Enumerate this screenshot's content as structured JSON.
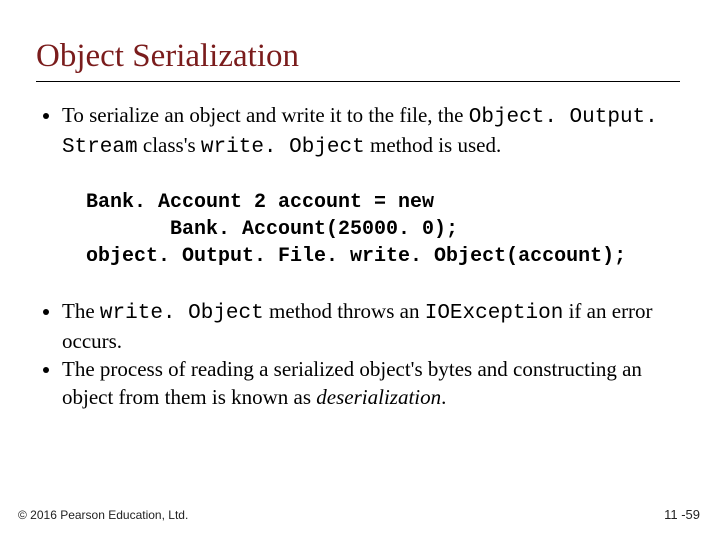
{
  "title": "Object Serialization",
  "bullets": {
    "b1_pre": "To serialize an object and write it to the file, the ",
    "b1_code1": "Object. Output. Stream",
    "b1_mid": " class's ",
    "b1_code2": "write. Object",
    "b1_post": " method is used.",
    "b2_pre": "The ",
    "b2_code1": "write. Object",
    "b2_mid": " method throws an ",
    "b2_code2": "IOException",
    "b2_post": " if an error occurs.",
    "b3_pre": "The process of reading a serialized object's bytes and constructing an object from them is known as ",
    "b3_em": "deserialization",
    "b3_post": "."
  },
  "code": "Bank. Account 2 account = new\n       Bank. Account(25000. 0);\nobject. Output. File. write. Object(account);",
  "footer": {
    "left": "© 2016 Pearson Education, Ltd.",
    "right": "11 -59"
  }
}
